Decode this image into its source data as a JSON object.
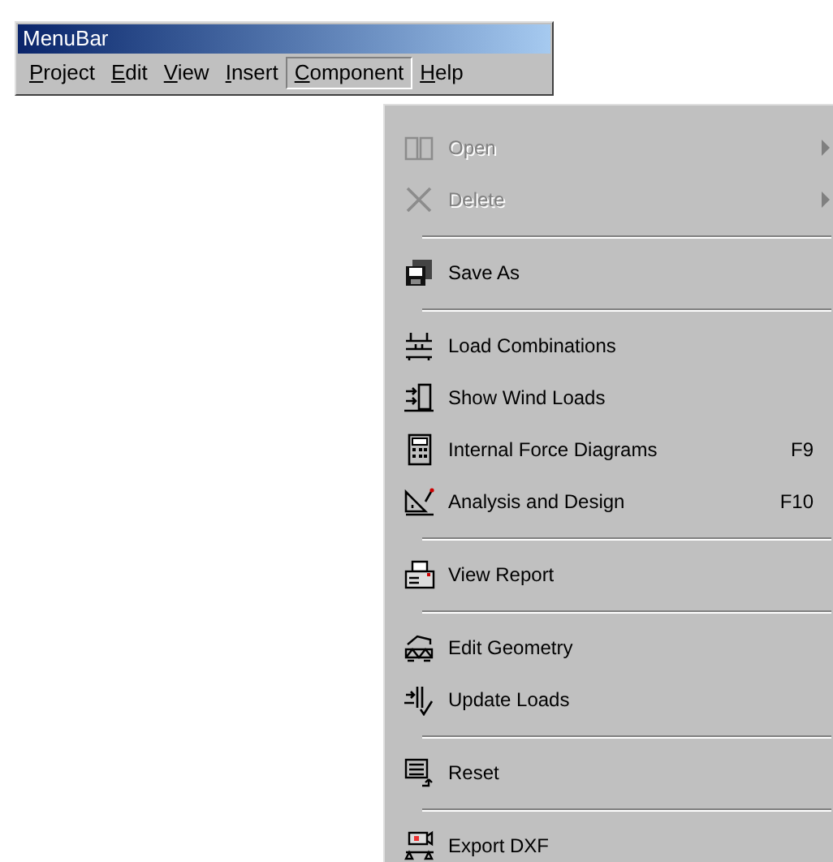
{
  "window": {
    "title": "MenuBar"
  },
  "menu_bar": [
    {
      "label": "Project",
      "underline_first": true,
      "selected": false
    },
    {
      "label": "Edit",
      "underline_first": true,
      "selected": false
    },
    {
      "label": "View",
      "underline_first": true,
      "selected": false
    },
    {
      "label": "Insert",
      "underline_first": true,
      "selected": false
    },
    {
      "label": "Component",
      "underline_first": true,
      "selected": true
    },
    {
      "label": "Help",
      "underline_first": true,
      "selected": false
    }
  ],
  "menu": [
    {
      "kind": "item",
      "label": "Open",
      "disabled": true,
      "submenu": true
    },
    {
      "kind": "item",
      "label": "Delete",
      "disabled": true,
      "submenu": true
    },
    {
      "kind": "separator"
    },
    {
      "kind": "item",
      "label": "Save As",
      "disabled": false,
      "submenu": false
    },
    {
      "kind": "separator"
    },
    {
      "kind": "item",
      "label": "Load Combinations",
      "disabled": false,
      "submenu": false
    },
    {
      "kind": "item",
      "label": "Show Wind Loads",
      "disabled": false,
      "submenu": false
    },
    {
      "kind": "item",
      "label": "Internal Force Diagrams",
      "shortcut": "F9",
      "disabled": false,
      "submenu": false
    },
    {
      "kind": "item",
      "label": "Analysis and Design",
      "shortcut": "F10",
      "disabled": false,
      "submenu": false
    },
    {
      "kind": "separator"
    },
    {
      "kind": "item",
      "label": "View Report",
      "disabled": false,
      "submenu": false
    },
    {
      "kind": "separator"
    },
    {
      "kind": "item",
      "label": "Edit Geometry",
      "disabled": false,
      "submenu": false
    },
    {
      "kind": "item",
      "label": "Update Loads",
      "disabled": false,
      "submenu": false
    },
    {
      "kind": "separator"
    },
    {
      "kind": "item",
      "label": "Reset",
      "disabled": false,
      "submenu": false
    },
    {
      "kind": "separator"
    },
    {
      "kind": "item",
      "label": "Export DXF",
      "disabled": false,
      "submenu": false
    }
  ]
}
